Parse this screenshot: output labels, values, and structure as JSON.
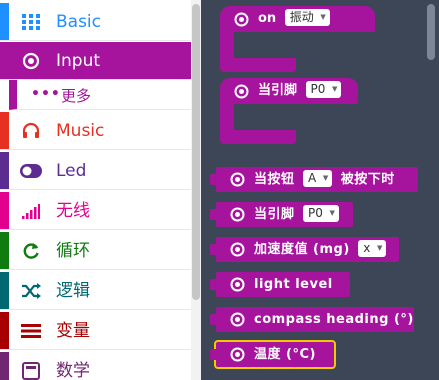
{
  "toolbox": {
    "categories": [
      {
        "label": "Basic",
        "color": "#1e90ff",
        "icon": "grid-icon"
      },
      {
        "label": "Input",
        "color": "#a6149e",
        "icon": "radio-target-icon",
        "selected": true
      },
      {
        "label": "Music",
        "color": "#e63022",
        "icon": "headphones-icon"
      },
      {
        "label": "Led",
        "color": "#5c2d91",
        "icon": "toggle-icon"
      },
      {
        "label": "无线",
        "color": "#e3008c",
        "icon": "signal-bars-icon"
      },
      {
        "label": "循环",
        "color": "#107c10",
        "icon": "refresh-icon"
      },
      {
        "label": "逻辑",
        "color": "#006970",
        "icon": "shuffle-icon"
      },
      {
        "label": "变量",
        "color": "#a80000",
        "icon": "list-bars-icon"
      },
      {
        "label": "数学",
        "color": "#712672",
        "icon": "calculator-icon"
      }
    ],
    "sub_item": {
      "label": "更多",
      "icon": "more-dots-icon"
    }
  },
  "workspace": {
    "accent": "#a6149e",
    "highlight": "#f5c900",
    "hat_blocks": [
      {
        "text": "on",
        "dropdown": "振动"
      },
      {
        "text": "当引脚",
        "dropdown": "P0"
      }
    ],
    "blocks": [
      {
        "text": "当按钮",
        "dropdown": "A",
        "suffix": "被按下时"
      },
      {
        "text": "当引脚",
        "dropdown": "P0"
      },
      {
        "text": "加速度值 (mg)",
        "dropdown": "x"
      },
      {
        "text": "light level"
      },
      {
        "text": "compass heading (°)"
      },
      {
        "text": "温度 (°C)",
        "highlighted": true
      }
    ]
  }
}
